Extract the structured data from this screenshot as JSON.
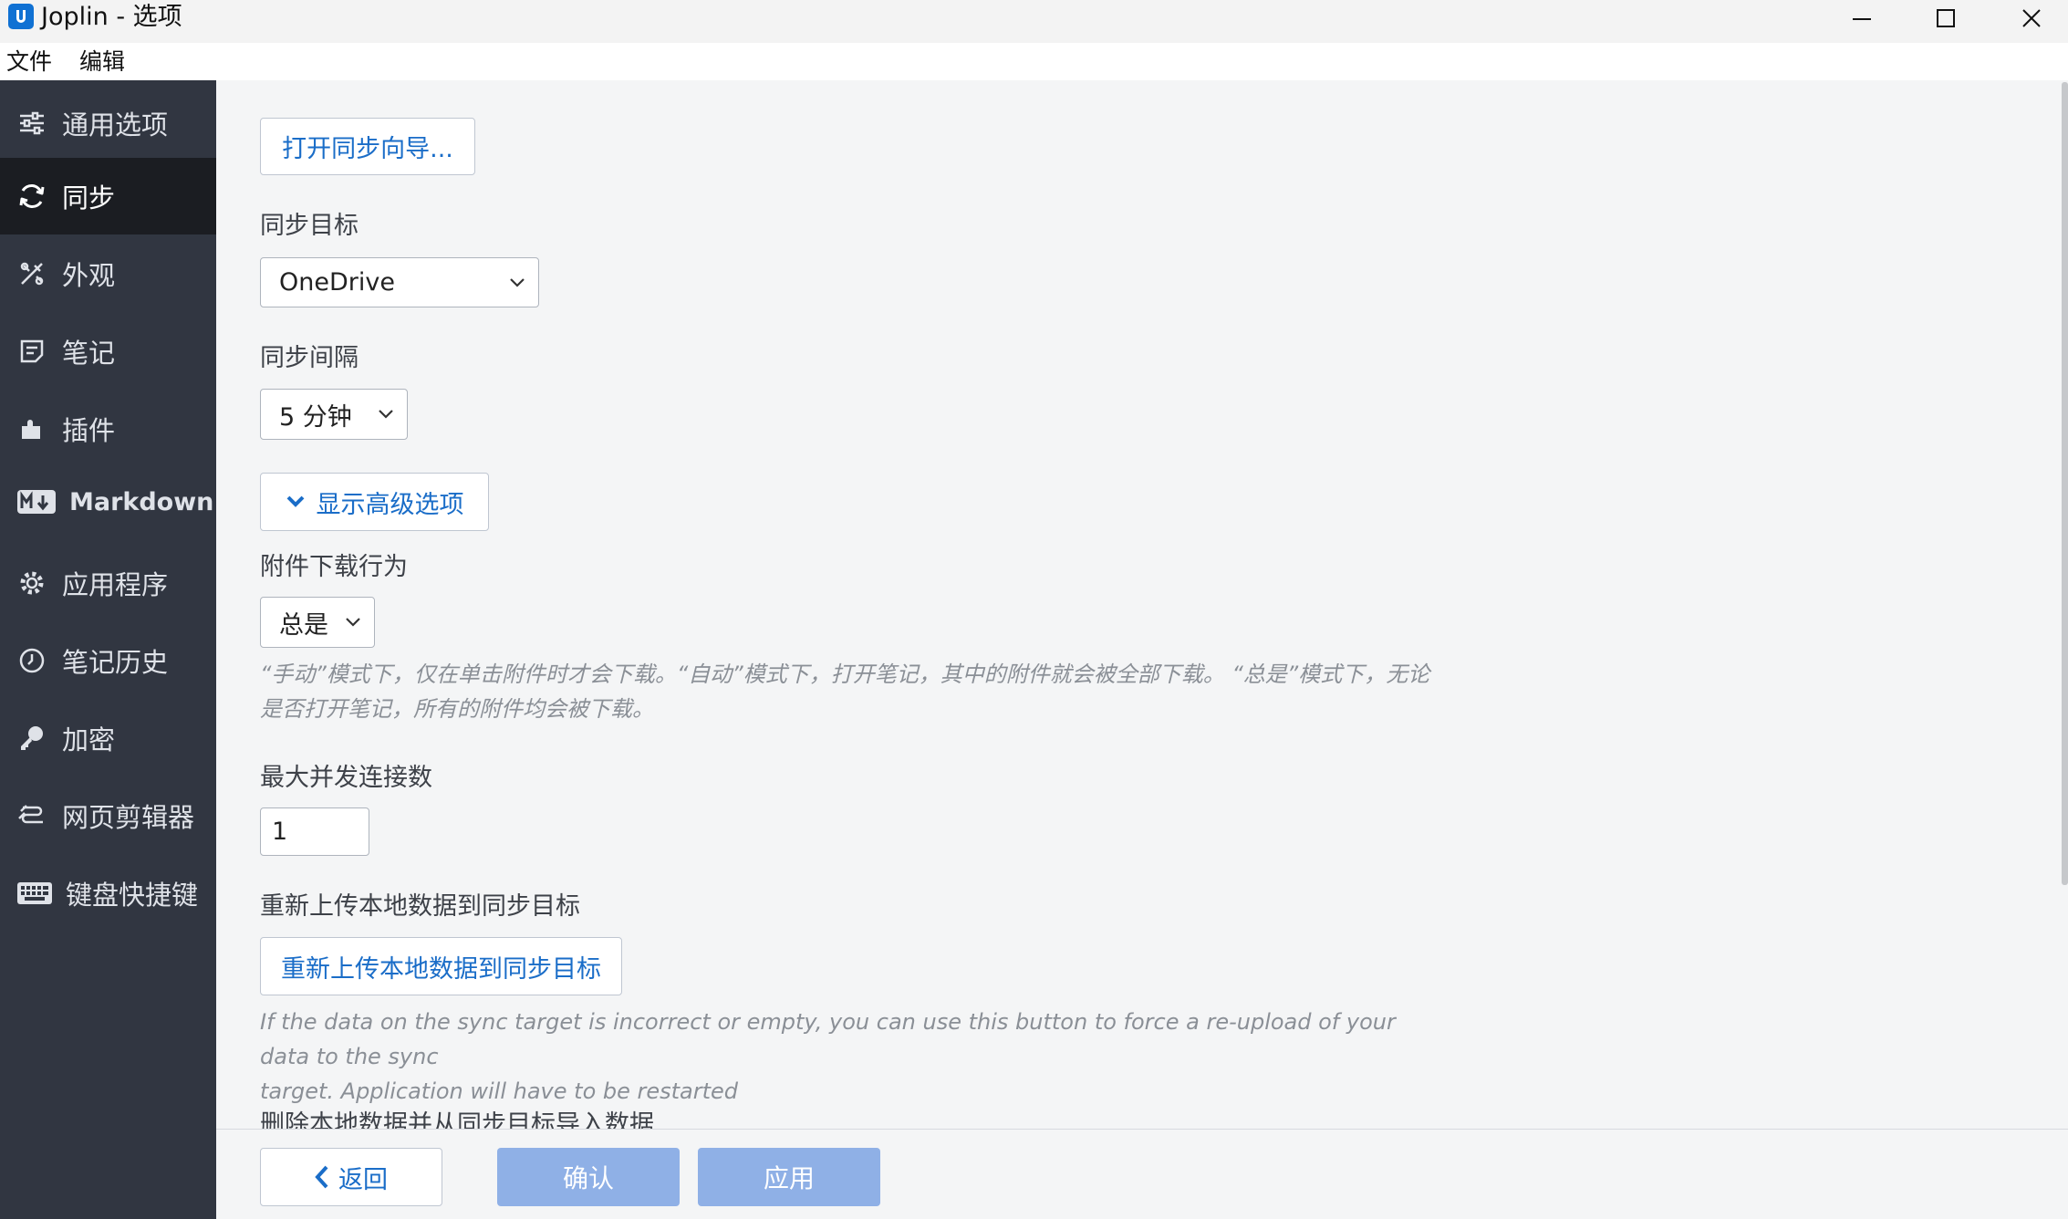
{
  "window": {
    "title": "Joplin - 选项"
  },
  "menubar": {
    "items": [
      "文件",
      "编辑"
    ]
  },
  "sidebar": {
    "items": [
      {
        "label": "通用选项",
        "icon": "sliders-icon"
      },
      {
        "label": "同步",
        "icon": "sync-icon",
        "active": true
      },
      {
        "label": "外观",
        "icon": "palette-icon"
      },
      {
        "label": "笔记",
        "icon": "note-icon"
      },
      {
        "label": "插件",
        "icon": "puzzle-icon"
      },
      {
        "label": "Markdown",
        "icon": "markdown-icon"
      },
      {
        "label": "应用程序",
        "icon": "gear-icon"
      },
      {
        "label": "笔记历史",
        "icon": "history-icon"
      },
      {
        "label": "加密",
        "icon": "key-icon"
      },
      {
        "label": "网页剪辑器",
        "icon": "clipper-icon"
      },
      {
        "label": "键盘快捷键",
        "icon": "keyboard-icon"
      }
    ]
  },
  "main": {
    "wizard_button": "打开同步向导...",
    "sync_target": {
      "label": "同步目标",
      "value": "OneDrive"
    },
    "sync_interval": {
      "label": "同步间隔",
      "value": "5 分钟"
    },
    "advanced_button": "显示高级选项",
    "attachment_download": {
      "label": "附件下载行为",
      "value": "总是",
      "help_line1": "“手动”模式下，仅在单击附件时才会下载。“自动”模式下，打开笔记，其中的附件就会被全部下载。 “总是”模式下，无论",
      "help_line2": "是否打开笔记，所有的附件均会被下载。"
    },
    "max_connections": {
      "label": "最大并发连接数",
      "value": "1"
    },
    "reupload": {
      "label": "重新上传本地数据到同步目标",
      "button": "重新上传本地数据到同步目标",
      "help_line1": "If the data on the sync target is incorrect or empty, you can use this button to force a re-upload of your data to the sync",
      "help_line2": "target. Application will have to be restarted"
    },
    "delete_local_label": "删除本地数据并从同步目标导入数据"
  },
  "footer": {
    "back": "返回",
    "ok": "确认",
    "apply": "应用"
  },
  "colors": {
    "accent": "#1a6dc8",
    "sidebar_bg": "#313641",
    "sidebar_active": "#1b1d22",
    "disabled_button": "#8fb0e6"
  }
}
